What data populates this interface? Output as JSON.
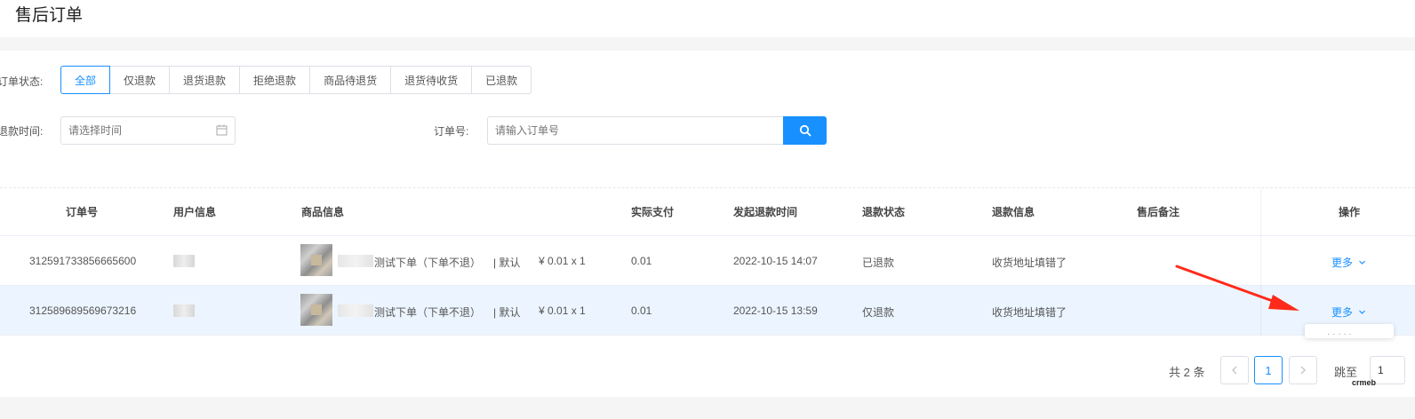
{
  "page": {
    "title": "售后订单"
  },
  "filters": {
    "status_label": "订单状态:",
    "status_tabs": [
      "全部",
      "仅退款",
      "退货退款",
      "拒绝退款",
      "商品待退货",
      "退货待收货",
      "已退款"
    ],
    "active_tab": "全部",
    "time_label": "退款时间:",
    "time_placeholder": "请选择时间",
    "order_label": "订单号:",
    "order_placeholder": "请输入订单号"
  },
  "table": {
    "headers": [
      "订单号",
      "用户信息",
      "商品信息",
      "实际支付",
      "发起退款时间",
      "退款状态",
      "退款信息",
      "售后备注",
      "操作"
    ],
    "rows": [
      {
        "order_no": "312591733856665600",
        "product_name": "测试下单（下单不退）",
        "spec": "| 默认",
        "price": "¥ 0.01 x 1",
        "paid": "0.01",
        "time": "2022-10-15 14:07",
        "status": "已退款",
        "reason": "收货地址填错了",
        "note": "",
        "action": "更多"
      },
      {
        "order_no": "312589689569673216",
        "product_name": "测试下单（下单不退）",
        "spec": "| 默认",
        "price": "¥ 0.01 x 1",
        "paid": "0.01",
        "time": "2022-10-15 13:59",
        "status": "仅退款",
        "reason": "收货地址填错了",
        "note": "",
        "action": "更多"
      }
    ]
  },
  "pagination": {
    "total": "共 2 条",
    "current": "1",
    "jump_label": "跳至",
    "jump_value": "1"
  },
  "watermark": "crmeb",
  "colors": {
    "accent": "#1890ff",
    "annotation_arrow": "#ff2a1a",
    "hover_row": "#ecf5ff"
  }
}
